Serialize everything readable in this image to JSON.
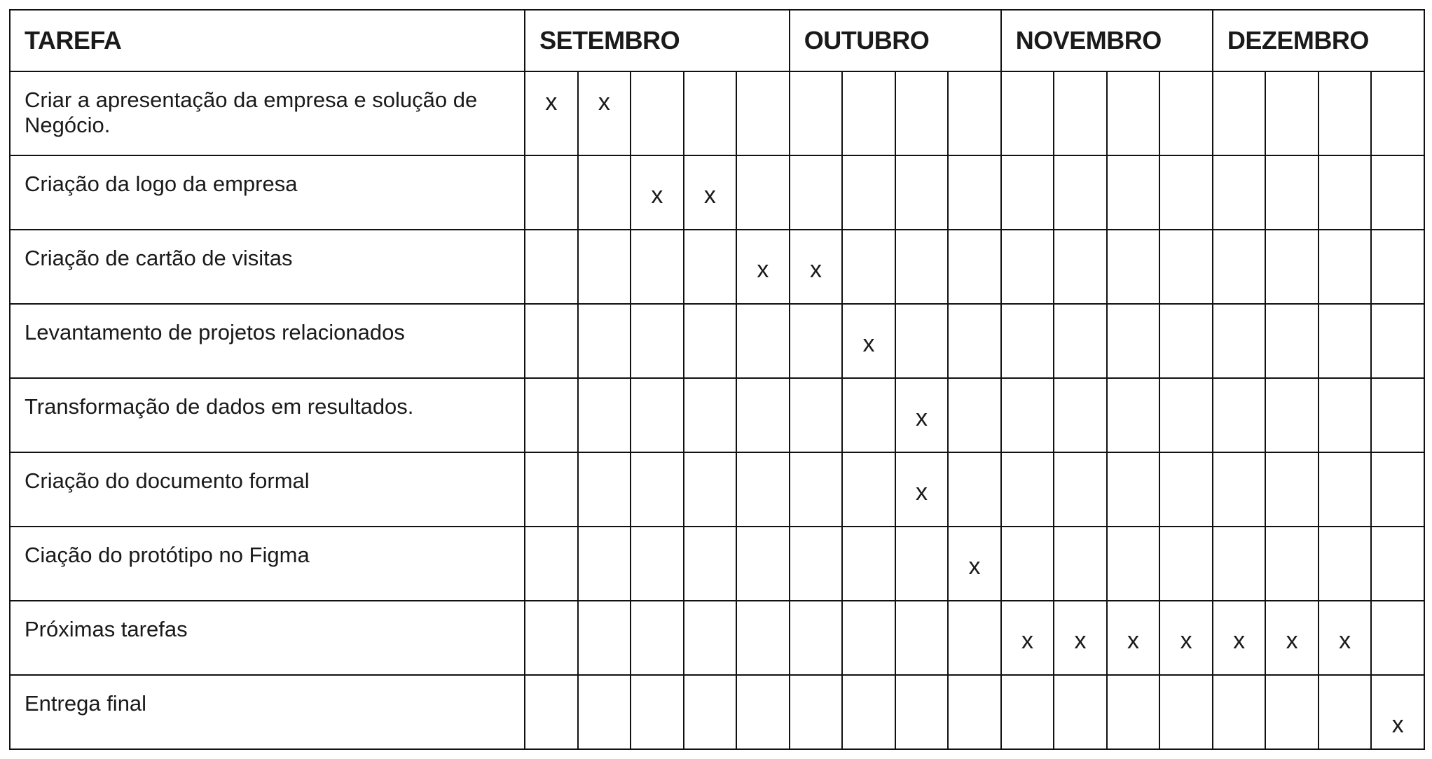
{
  "header": {
    "task_label": "TAREFA",
    "months": [
      {
        "label": "SETEMBRO",
        "weeks": 5
      },
      {
        "label": "OUTUBRO",
        "weeks": 4
      },
      {
        "label": "NOVEMBRO",
        "weeks": 4
      },
      {
        "label": "DEZEMBRO",
        "weeks": 4
      }
    ]
  },
  "rows": [
    {
      "task": "Criar a apresentação da empresa e solução de Negócio.",
      "cells": [
        "x",
        "x",
        "",
        "",
        "",
        "",
        "",
        "",
        "",
        "",
        "",
        "",
        "",
        "",
        "",
        "",
        ""
      ]
    },
    {
      "task": "Criação da logo da empresa",
      "cells": [
        "",
        "",
        "x",
        "x",
        "",
        "",
        "",
        "",
        "",
        "",
        "",
        "",
        "",
        "",
        "",
        "",
        ""
      ]
    },
    {
      "task": "Criação de cartão de visitas",
      "cells": [
        "",
        "",
        "",
        "",
        "x",
        "x",
        "",
        "",
        "",
        "",
        "",
        "",
        "",
        "",
        "",
        "",
        ""
      ]
    },
    {
      "task": "Levantamento de projetos relacionados",
      "cells": [
        "",
        "",
        "",
        "",
        "",
        "",
        "x",
        "",
        "",
        "",
        "",
        "",
        "",
        "",
        "",
        "",
        ""
      ]
    },
    {
      "task": "Transformação de dados em resultados.",
      "cells": [
        "",
        "",
        "",
        "",
        "",
        "",
        "",
        "x",
        "",
        "",
        "",
        "",
        "",
        "",
        "",
        "",
        ""
      ]
    },
    {
      "task": "Criação do documento formal",
      "cells": [
        "",
        "",
        "",
        "",
        "",
        "",
        "",
        "x",
        "",
        "",
        "",
        "",
        "",
        "",
        "",
        "",
        ""
      ]
    },
    {
      "task": "Ciação do protótipo no Figma",
      "cells": [
        "",
        "",
        "",
        "",
        "",
        "",
        "",
        "",
        "x",
        "",
        "",
        "",
        "",
        "",
        "",
        "",
        ""
      ]
    },
    {
      "task": "Próximas tarefas",
      "cells": [
        "",
        "",
        "",
        "",
        "",
        "",
        "",
        "",
        "",
        "x",
        "x",
        "x",
        "x",
        "x",
        "x",
        "x",
        ""
      ]
    },
    {
      "task": "Entrega final",
      "cells": [
        "",
        "",
        "",
        "",
        "",
        "",
        "",
        "",
        "",
        "",
        "",
        "",
        "",
        "",
        "",
        "",
        "x"
      ]
    }
  ]
}
